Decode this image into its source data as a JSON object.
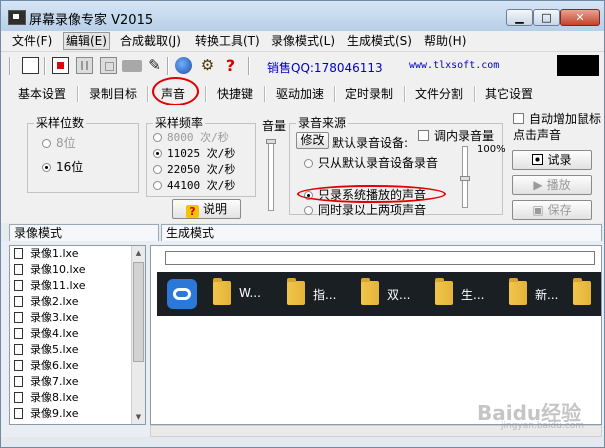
{
  "window": {
    "title": "屏幕录像专家 V2015"
  },
  "menu": [
    "文件(F)",
    "编辑(E)",
    "合成截取(J)",
    "转换工具(T)",
    "录像模式(L)",
    "生成模式(S)",
    "帮助(H)"
  ],
  "toolbar": {
    "qq": "销售QQ:178046113",
    "site": "www.tlxsoft.com"
  },
  "tabs": [
    "基本设置",
    "录制目标",
    "声音",
    "快捷键",
    "驱动加速",
    "定时录制",
    "文件分割",
    "其它设置"
  ],
  "bits": {
    "title": "采样位数",
    "opt8": "8位",
    "opt16": "16位"
  },
  "freq": {
    "title": "采样频率",
    "o1": "8000 次/秒",
    "o2": "11025 次/秒",
    "o3": "22050 次/秒",
    "o4": "44100 次/秒",
    "help": "说明"
  },
  "volume": {
    "label": "音量"
  },
  "source": {
    "title": "录音来源",
    "modify": "修改",
    "default_label": "默认录音设备:",
    "adjust": "调内录音量",
    "percent": "100%",
    "opt1": "只从默认录音设备录音",
    "opt2": "只录系统播放的声音",
    "opt3": "同时录以上两项声音"
  },
  "right": {
    "auto_mouse": "自动增加鼠标点击声音",
    "try": "试录",
    "play": "播放",
    "save": "保存"
  },
  "modes": {
    "record": "录像模式",
    "generate": "生成模式"
  },
  "files": [
    "录像1.lxe",
    "录像10.lxe",
    "录像11.lxe",
    "录像2.lxe",
    "录像3.lxe",
    "录像4.lxe",
    "录像5.lxe",
    "录像6.lxe",
    "录像7.lxe",
    "录像8.lxe",
    "录像9.lxe"
  ],
  "preview": {
    "folders": [
      "W...",
      "指...",
      "双...",
      "生...",
      "新..."
    ]
  },
  "watermark": {
    "brand": "Baidu经验",
    "url": "jingyan.baidu.com"
  }
}
